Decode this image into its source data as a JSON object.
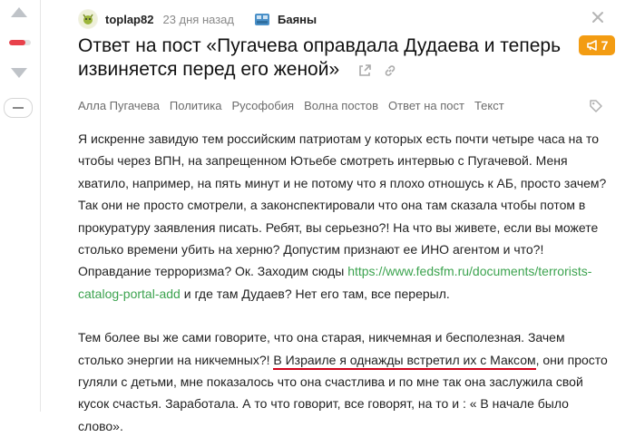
{
  "post": {
    "username": "toplap82",
    "time_ago": "23 дня назад",
    "community": "Баяны",
    "title": "Ответ на пост «Пугачева оправдала Дудаева и теперь извиняется перед его женой»",
    "badge_count": "7",
    "rating_fraction": 0.75,
    "tags": [
      "Алла Пугачева",
      "Политика",
      "Русофобия",
      "Волна постов",
      "Ответ на пост",
      "Текст"
    ],
    "paragraph1_before_link": "Я искренне завидую тем российским патриотам у которых есть почти четыре часа на то чтобы через ВПН, на запрещенном Ютьебе смотреть интервью с Пугачевой. Меня хватило, например, на пять минут и не потому что я плохо отношусь к АБ, просто зачем? Так они не просто смотрели, а законспектировали что она там сказала чтобы потом в прокуратуру заявления писать. Ребят, вы серьезно?! На что вы живете, если вы можете столько времени убить на херню? Допустим признают ее ИНО агентом и что?! Оправдание терроризма? Ок. Заходим сюды ",
    "paragraph1_link": "https://www.fedsfm.ru/documents/terrorists-catalog-portal-add",
    "paragraph1_after_link": " и где там Дудаев? Нет его там, все перерыл.",
    "paragraph2_before": "Тем более вы же сами говорите, что она старая, никчемная и бесполезная. Зачем столько энергии на никчемных?! ",
    "paragraph2_underlined": "В Израиле я однажды встретил их с Максом",
    "paragraph2_after": ", они просто гуляли с детьми, мне показалось что она счастлива и по мне так она заслужила свой кусок счастья. Заработала. А то что говорит, все говорят, на то и : « В начале было слово»."
  },
  "colors": {
    "accent": "#f39c12",
    "link": "#3ca34f",
    "rating": "#e8414b",
    "underline": "#d0021b"
  },
  "icons": [
    "arrow-up-icon",
    "arrow-down-icon",
    "minus-icon",
    "close-icon",
    "share-icon",
    "link-icon",
    "megaphone-icon",
    "tag-icon"
  ]
}
